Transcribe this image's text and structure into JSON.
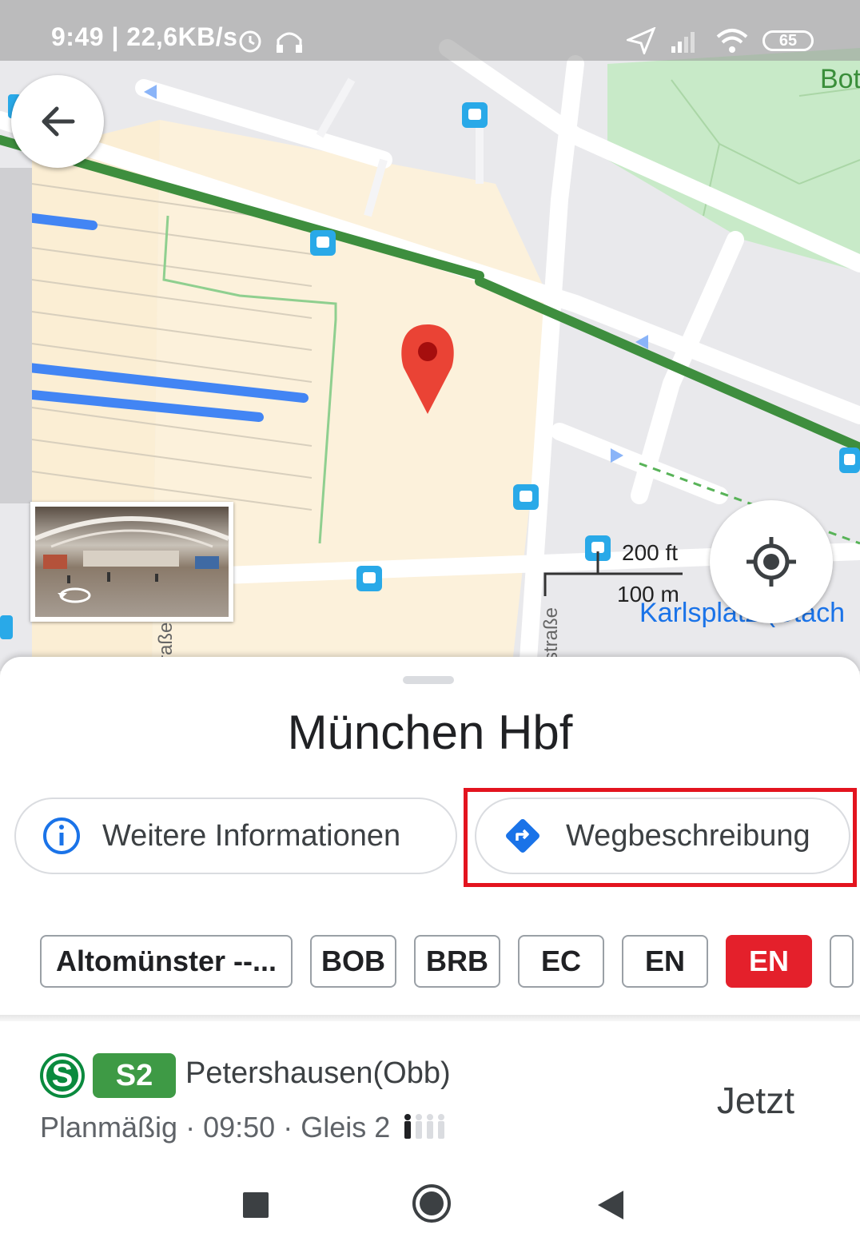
{
  "status_bar": {
    "time": "9:49 | 22,6KB/s",
    "battery": "65"
  },
  "map": {
    "scale_imperial": "200 ft",
    "scale_metric": "100 m",
    "label_karlsplatz": "Karlsplatz (Stach",
    "label_bot": "Bot",
    "street_left": "raße",
    "street_right": "straße"
  },
  "place": {
    "title": "München Hbf"
  },
  "actions": {
    "more_info": "Weitere Informationen",
    "directions": "Wegbeschreibung"
  },
  "filter_chips": [
    {
      "label": "Altomünster --..."
    },
    {
      "label": "BOB"
    },
    {
      "label": "BRB"
    },
    {
      "label": "EC"
    },
    {
      "label": "EN"
    },
    {
      "label": "EN",
      "selected": true
    }
  ],
  "departure": {
    "system": "S",
    "line": "S2",
    "destination": "Petershausen(Obb)",
    "status": "Planmäßig",
    "time": "09:50",
    "platform": "Gleis 2",
    "when": "Jetzt"
  },
  "colors": {
    "accent": "#1a73e8",
    "highlight": "#e3141f",
    "line_s2": "#3e9a45",
    "chip_selected": "#e4202b"
  }
}
